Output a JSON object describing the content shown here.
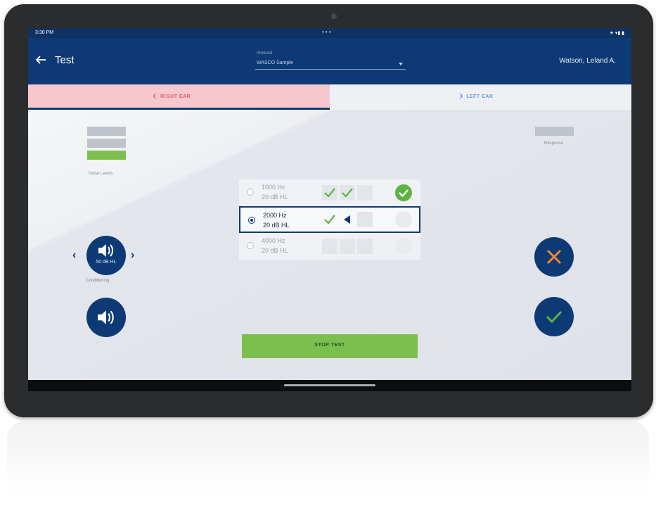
{
  "status_bar": {
    "time": "3:30 PM",
    "right_icons": "⁕ ▾▮ ▮"
  },
  "header": {
    "title": "Test",
    "protocol_label": "Protocol",
    "protocol_value": "WASCO Sample",
    "patient_name": "Watson, Leland A."
  },
  "tabs": [
    {
      "label": "RIGHT EAR",
      "active": true,
      "color": "#e0606b"
    },
    {
      "label": "LEFT EAR",
      "active": false,
      "color": "#6a9bd4"
    }
  ],
  "noise_meter": {
    "label": "Noise Levels",
    "level": "1 of 3"
  },
  "response_meter": {
    "label": "Response"
  },
  "frequencies": [
    {
      "freq": "1000 Hz",
      "level": "20 dB HL",
      "responses": [
        "check",
        "check",
        "empty"
      ],
      "result": "pass"
    },
    {
      "freq": "2000 Hz",
      "level": "20 dB HL",
      "responses": [
        "check",
        "playing",
        "empty"
      ],
      "result": "pending",
      "selected": true
    },
    {
      "freq": "4000 Hz",
      "level": "20 dB HL",
      "responses": [
        "empty",
        "empty",
        "empty"
      ],
      "result": "pending"
    }
  ],
  "conditioning": {
    "level": "50 dB HL",
    "label": "Conditioning"
  },
  "buttons": {
    "stop_test": "STOP TEST"
  },
  "colors": {
    "primary": "#0d3a75",
    "accent_green": "#7bbf4e",
    "pass_green": "#5fb244",
    "reject_orange": "#f0892b"
  }
}
